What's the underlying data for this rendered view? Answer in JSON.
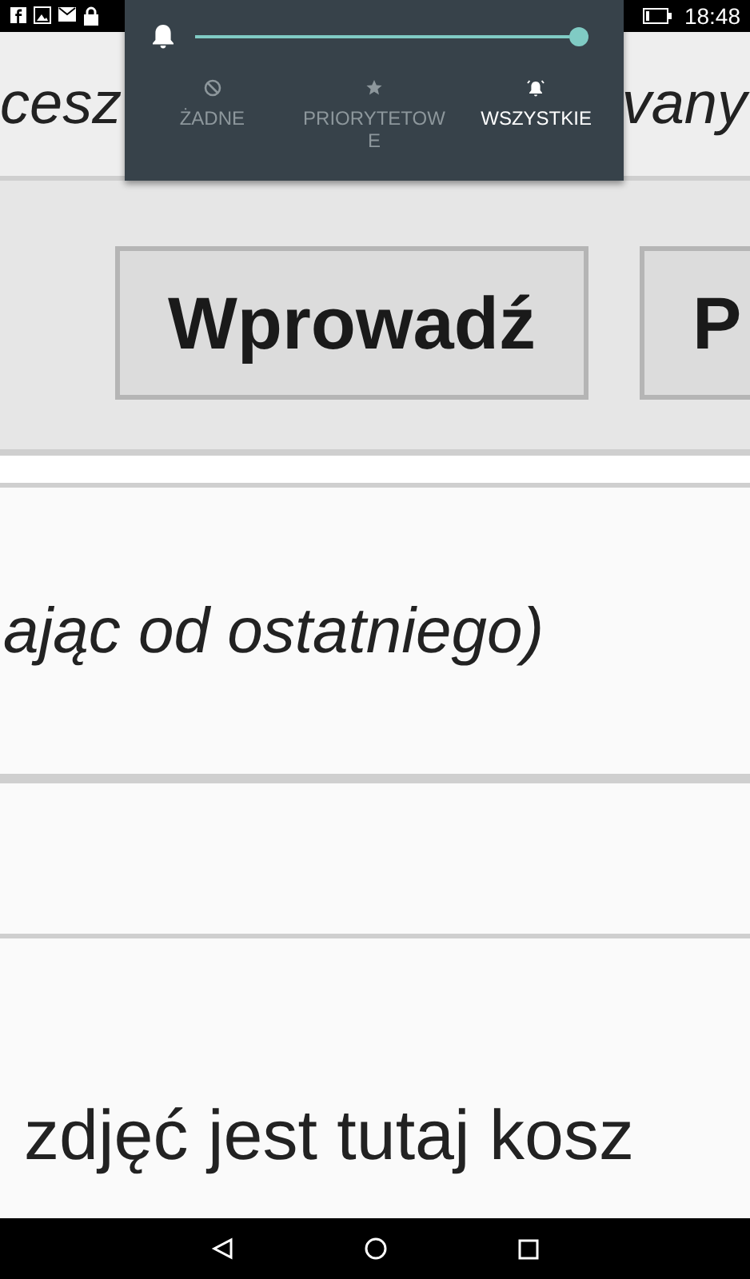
{
  "status_bar": {
    "time": "18:48"
  },
  "header": {
    "left_text": "cesz",
    "right_text": "vany"
  },
  "buttons": [
    {
      "label": "Wprowadź"
    },
    {
      "label": "P"
    }
  ],
  "content": {
    "line_1": "ając od ostatniego)",
    "line_2": "zdjęć jest tutaj kosz"
  },
  "volume_panel": {
    "level": 1.0,
    "modes": [
      {
        "label": "ŻADNE",
        "kind": "none",
        "selected": false
      },
      {
        "label": "PRIORYTETOW\nE",
        "kind": "priority",
        "selected": false
      },
      {
        "label": "WSZYSTKIE",
        "kind": "all",
        "selected": true
      }
    ]
  }
}
